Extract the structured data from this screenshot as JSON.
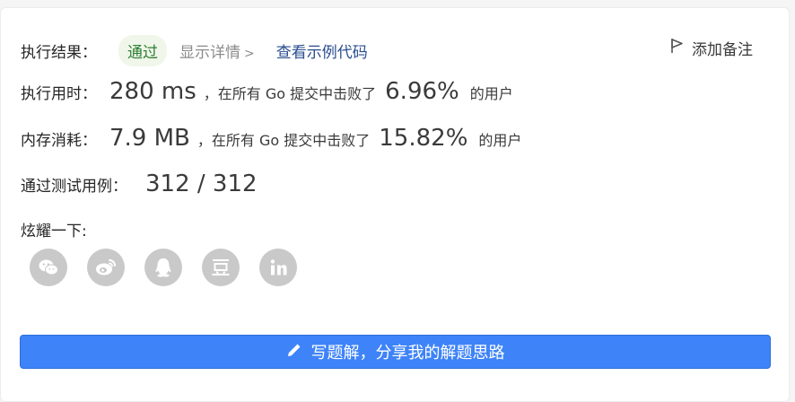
{
  "result": {
    "label": "执行结果：",
    "status": "通过",
    "details": "显示详情",
    "example_code": "查看示例代码",
    "add_note": "添加备注"
  },
  "runtime": {
    "label": "执行用时：",
    "value": "280 ms",
    "phrase": "，在所有 Go 提交中击败了",
    "percent": "6.96%",
    "suffix": "的用户"
  },
  "memory": {
    "label": "内存消耗：",
    "value": "7.9 MB",
    "phrase": "，在所有 Go 提交中击败了",
    "percent": "15.82%",
    "suffix": "的用户"
  },
  "tests": {
    "label": "通过测试用例：",
    "value": "312 / 312"
  },
  "share": {
    "label": "炫耀一下:",
    "icons": [
      "wechat-icon",
      "weibo-icon",
      "qq-icon",
      "douban-icon",
      "linkedin-icon"
    ]
  },
  "write_solution": {
    "label": "写题解，分享我的解题思路"
  },
  "colors": {
    "accent": "#3e83f8",
    "pass_bg": "#f0f7ea",
    "pass_text": "#2e7d32",
    "link": "#2a4d8f",
    "share_icon_bg": "#c9c9c9"
  }
}
